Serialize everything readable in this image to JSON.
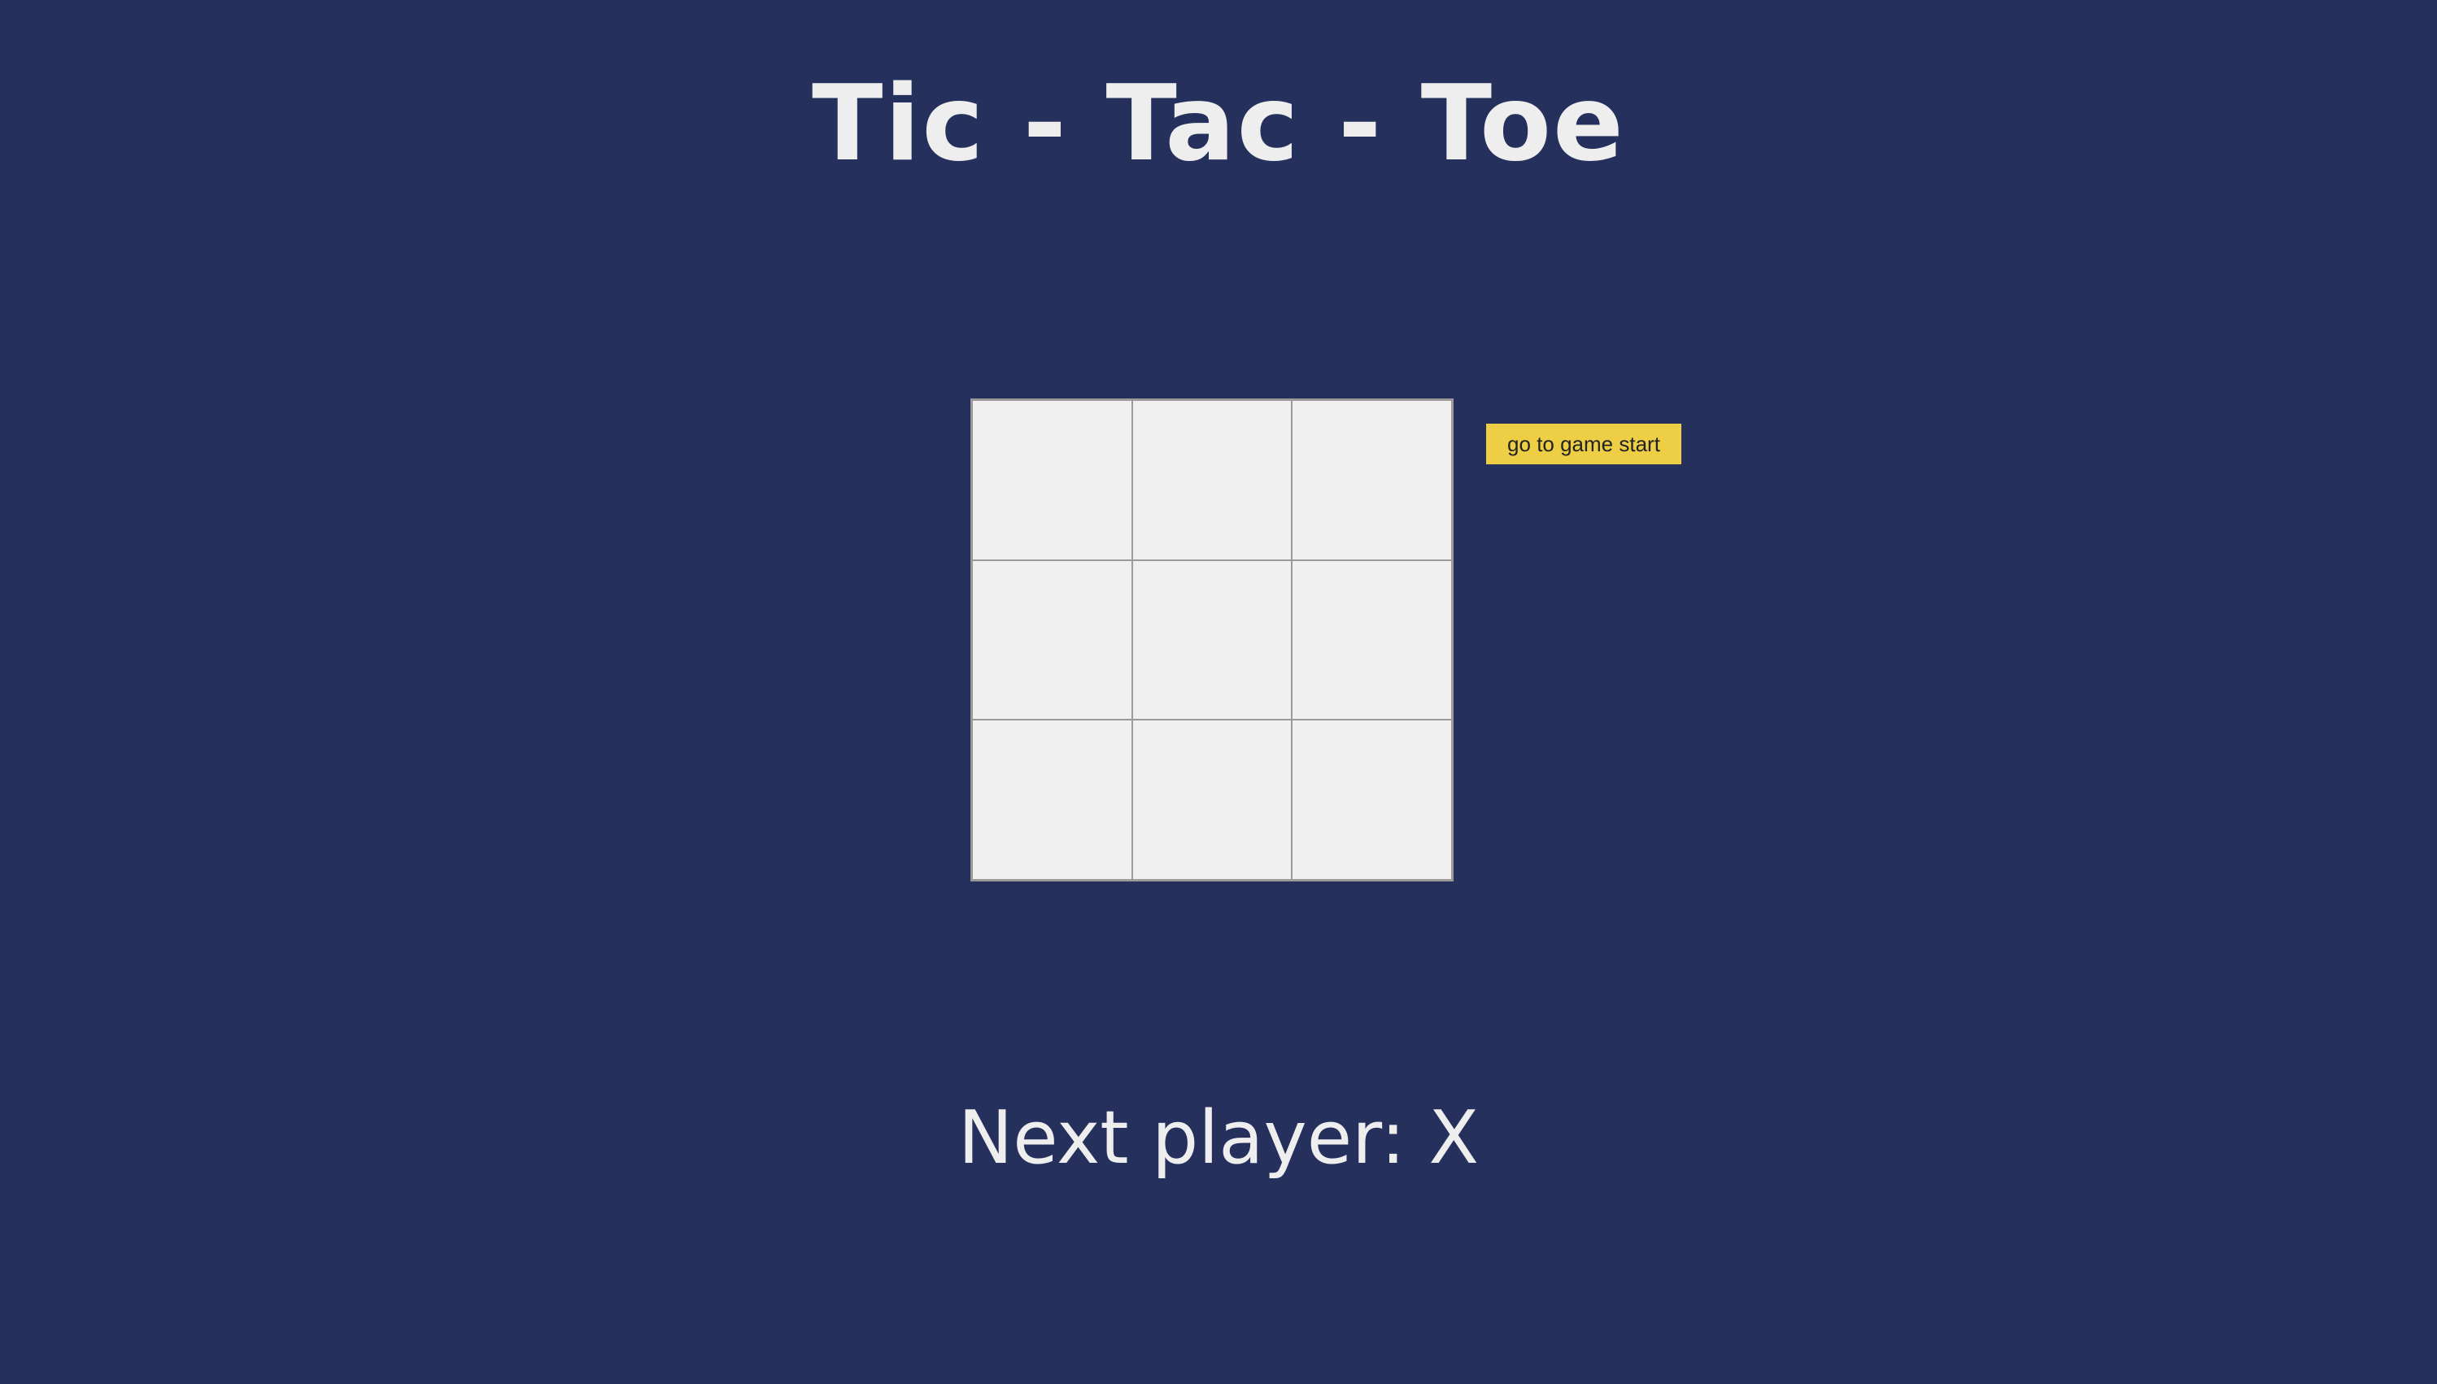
{
  "page": {
    "title": "Tic - Tac - Toe",
    "background_color": "#25315c",
    "text_color": "#eeeeee"
  },
  "board": {
    "cell_color": "#f0f0f0",
    "grid_color": "#9a9a9a",
    "squares": [
      "",
      "",
      "",
      "",
      "",
      "",
      "",
      "",
      ""
    ]
  },
  "history": {
    "moves": [
      {
        "label": "go to game start",
        "color": "#edce45"
      }
    ]
  },
  "status": {
    "text": "Next player: X"
  }
}
